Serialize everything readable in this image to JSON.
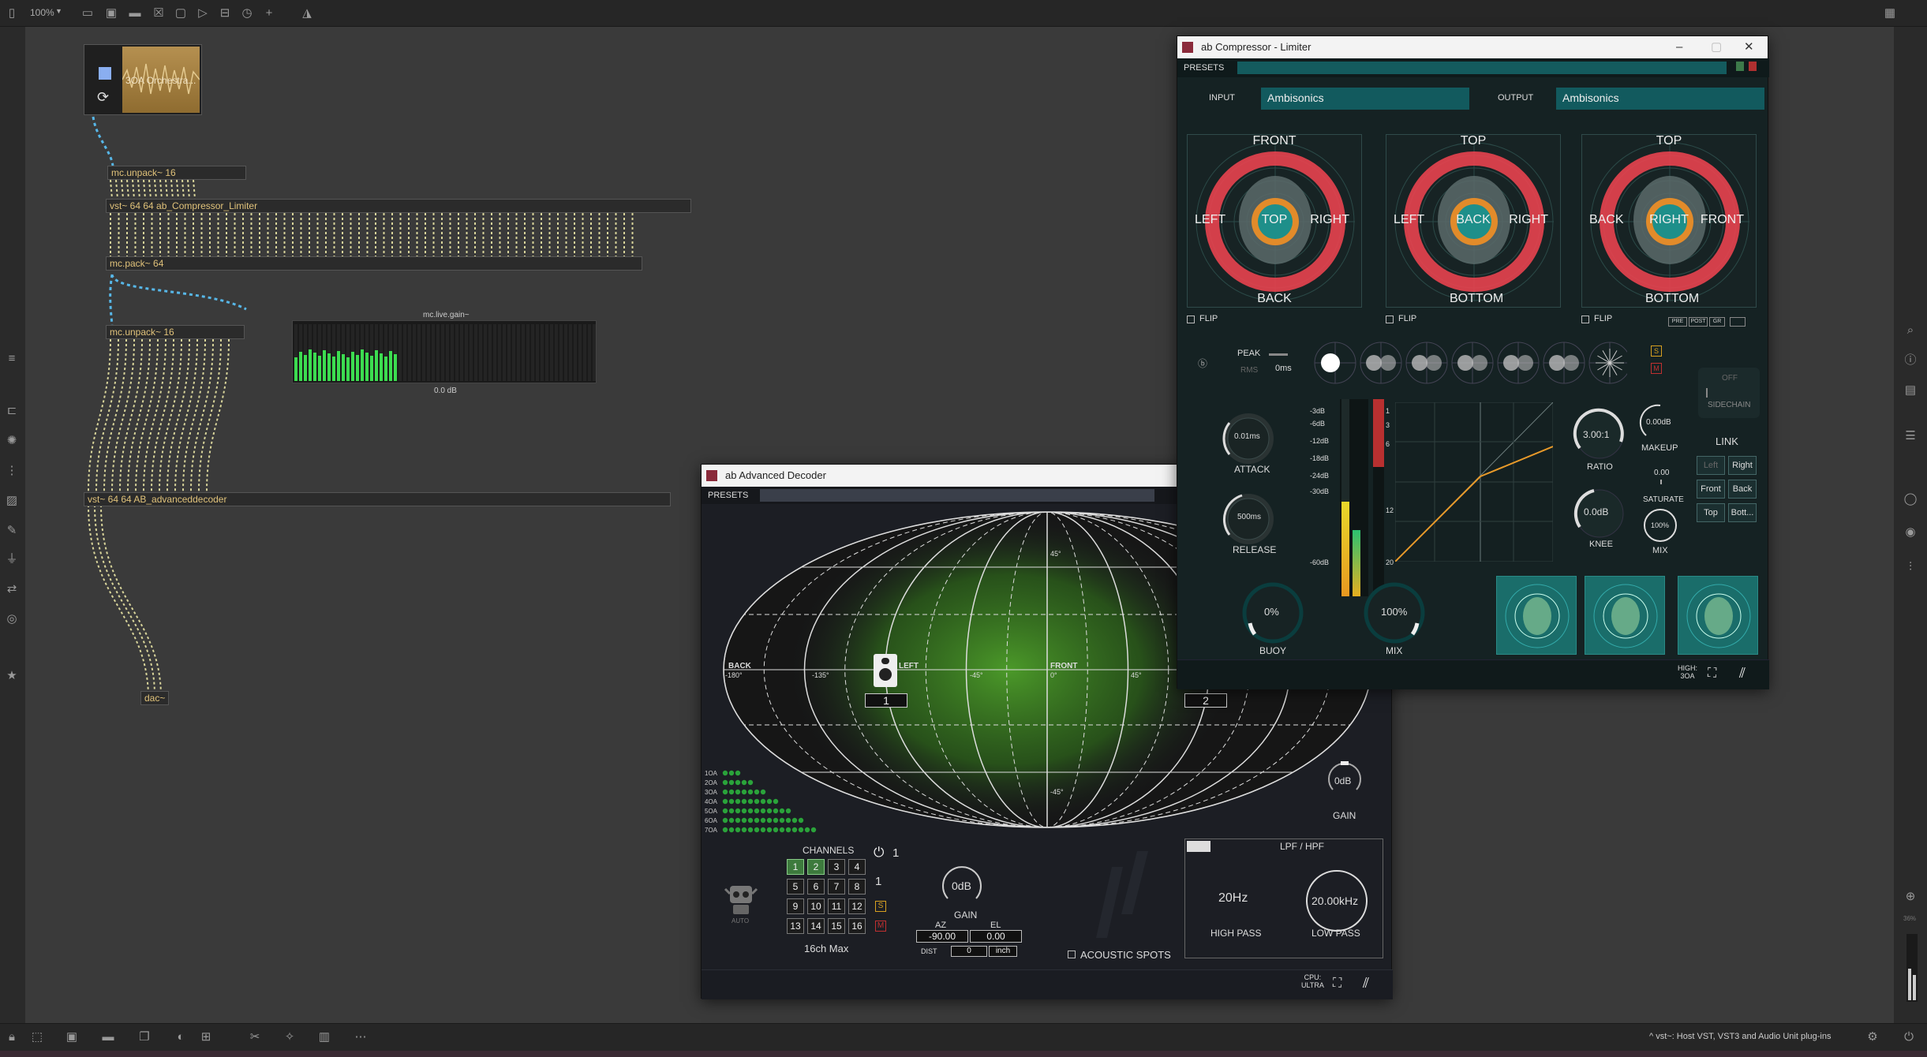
{
  "toolbar": {
    "zoom": "100%"
  },
  "patch": {
    "sample_label": "3OA Orchestra...",
    "obj_unpack1": "mc.unpack~ 16",
    "obj_vst1": "vst~ 64 64 ab_Compressor_Limiter",
    "obj_pack": "mc.pack~ 64",
    "obj_unpack2": "mc.unpack~ 16",
    "obj_vst2": "vst~ 64 64 AB_advanceddecoder",
    "obj_dac": "dac~",
    "gain_title": "mc.live.gain~",
    "gain_value": "0.0 dB"
  },
  "status": {
    "text": "^ vst~: Host VST, VST3 and Audio Unit plug-ins"
  },
  "compressor": {
    "title": "ab Compressor - Limiter",
    "presets": "PRESETS",
    "input_label": "INPUT",
    "input_value": "Ambisonics",
    "output_label": "OUTPUT",
    "output_value": "Ambisonics",
    "view1": {
      "top": "FRONT",
      "bottom": "BACK",
      "left": "LEFT",
      "right": "RIGHT",
      "center": "TOP"
    },
    "view2": {
      "top": "TOP",
      "bottom": "BOTTOM",
      "left": "LEFT",
      "right": "RIGHT",
      "center": "BACK"
    },
    "view3": {
      "top": "TOP",
      "bottom": "BOTTOM",
      "left": "BACK",
      "right": "FRONT",
      "center": "RIGHT"
    },
    "flip": "FLIP",
    "meter_btns": {
      "pre": "PRE",
      "post": "POST",
      "gr": "GR"
    },
    "peak": "PEAK",
    "rms": "RMS",
    "peak_time": "0ms",
    "sidechain_off": "OFF",
    "sidechain": "SIDECHAIN",
    "attack_value": "0.01ms",
    "attack": "ATTACK",
    "release_value": "500ms",
    "release": "RELEASE",
    "db_scale": [
      "-3dB",
      "-6dB",
      "-12dB",
      "-18dB",
      "-24dB",
      "-30dB",
      "-60dB"
    ],
    "gr_scale": [
      "1",
      "3",
      "6",
      "12",
      "20"
    ],
    "ratio_value": "3.00:1",
    "ratio": "RATIO",
    "knee_value": "0.0dB",
    "knee": "KNEE",
    "makeup_value": "0.00dB",
    "makeup": "MAKEUP",
    "saturate_value": "0.00",
    "saturate": "SATURATE",
    "mix_small_value": "100%",
    "mix_small": "MIX",
    "link": "LINK",
    "link_btns": [
      "Left",
      "Right",
      "Front",
      "Back",
      "Top",
      "Bott..."
    ],
    "buoy_value": "0%",
    "buoy": "BUOY",
    "mix_value": "100%",
    "mix": "MIX",
    "quality": "HIGH:\n3OA",
    "solo": "S",
    "mute": "M",
    "accent": "#e8434f",
    "teal": "#1e8f8a",
    "orange": "#e28b2a"
  },
  "decoder": {
    "title": "ab Advanced Decoder",
    "presets": "PRESETS",
    "map": {
      "back": "BACK",
      "front": "FRONT",
      "lon_labels": [
        "-180°",
        "-135°",
        "-45°",
        "0°",
        "45°"
      ],
      "lat_labels": [
        "45°",
        "-45°"
      ],
      "left_label": "LEFT"
    },
    "speaker1": "1",
    "speaker2": "2",
    "orders": [
      "1OA",
      "2OA",
      "3OA",
      "4OA",
      "5OA",
      "6OA",
      "7OA"
    ],
    "auto": "AUTO",
    "channels_label": "CHANNELS",
    "channels": [
      "1",
      "2",
      "3",
      "4",
      "5",
      "6",
      "7",
      "8",
      "9",
      "10",
      "11",
      "12",
      "13",
      "14",
      "15",
      "16"
    ],
    "max": "16ch Max",
    "power_count": "1",
    "sel_count": "1",
    "solo": "S",
    "mute": "M",
    "gain_value": "0dB",
    "gain": "GAIN",
    "az": "AZ",
    "el": "EL",
    "az_value": "-90.00",
    "el_value": "0.00",
    "dist": "DIST",
    "dist_value": "0",
    "unit": "inch",
    "acoustic": "ACOUSTIC SPOTS",
    "gain_right_value": "0dB",
    "gain_right": "GAIN",
    "filter_title": "LPF / HPF",
    "hp_value": "20Hz",
    "hp": "HIGH PASS",
    "lp_value": "20.00kHz",
    "lp": "LOW PASS",
    "cpu": "CPU:\nULTRA"
  }
}
